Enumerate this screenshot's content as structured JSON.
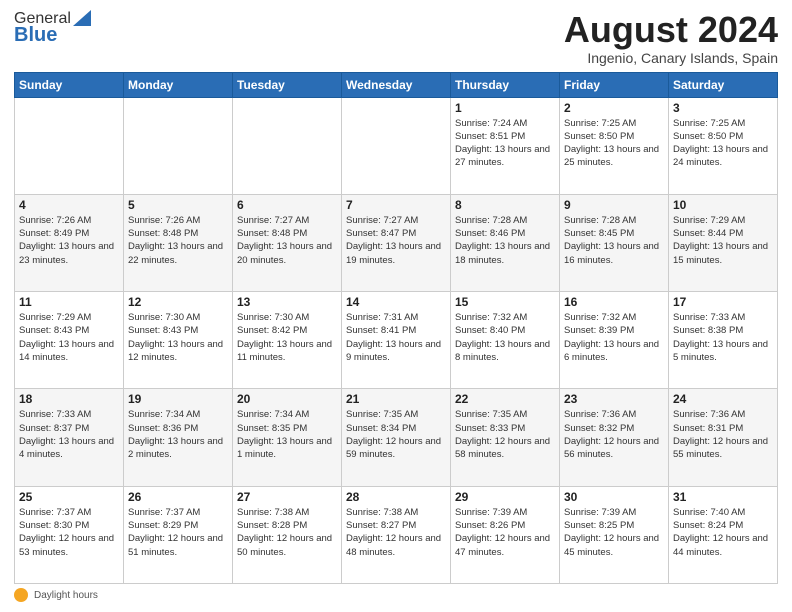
{
  "logo": {
    "general": "General",
    "blue": "Blue"
  },
  "title": "August 2024",
  "location": "Ingenio, Canary Islands, Spain",
  "days_of_week": [
    "Sunday",
    "Monday",
    "Tuesday",
    "Wednesday",
    "Thursday",
    "Friday",
    "Saturday"
  ],
  "footer_label": "Daylight hours",
  "weeks": [
    [
      {
        "day": "",
        "info": ""
      },
      {
        "day": "",
        "info": ""
      },
      {
        "day": "",
        "info": ""
      },
      {
        "day": "",
        "info": ""
      },
      {
        "day": "1",
        "info": "Sunrise: 7:24 AM\nSunset: 8:51 PM\nDaylight: 13 hours and 27 minutes."
      },
      {
        "day": "2",
        "info": "Sunrise: 7:25 AM\nSunset: 8:50 PM\nDaylight: 13 hours and 25 minutes."
      },
      {
        "day": "3",
        "info": "Sunrise: 7:25 AM\nSunset: 8:50 PM\nDaylight: 13 hours and 24 minutes."
      }
    ],
    [
      {
        "day": "4",
        "info": "Sunrise: 7:26 AM\nSunset: 8:49 PM\nDaylight: 13 hours and 23 minutes."
      },
      {
        "day": "5",
        "info": "Sunrise: 7:26 AM\nSunset: 8:48 PM\nDaylight: 13 hours and 22 minutes."
      },
      {
        "day": "6",
        "info": "Sunrise: 7:27 AM\nSunset: 8:48 PM\nDaylight: 13 hours and 20 minutes."
      },
      {
        "day": "7",
        "info": "Sunrise: 7:27 AM\nSunset: 8:47 PM\nDaylight: 13 hours and 19 minutes."
      },
      {
        "day": "8",
        "info": "Sunrise: 7:28 AM\nSunset: 8:46 PM\nDaylight: 13 hours and 18 minutes."
      },
      {
        "day": "9",
        "info": "Sunrise: 7:28 AM\nSunset: 8:45 PM\nDaylight: 13 hours and 16 minutes."
      },
      {
        "day": "10",
        "info": "Sunrise: 7:29 AM\nSunset: 8:44 PM\nDaylight: 13 hours and 15 minutes."
      }
    ],
    [
      {
        "day": "11",
        "info": "Sunrise: 7:29 AM\nSunset: 8:43 PM\nDaylight: 13 hours and 14 minutes."
      },
      {
        "day": "12",
        "info": "Sunrise: 7:30 AM\nSunset: 8:43 PM\nDaylight: 13 hours and 12 minutes."
      },
      {
        "day": "13",
        "info": "Sunrise: 7:30 AM\nSunset: 8:42 PM\nDaylight: 13 hours and 11 minutes."
      },
      {
        "day": "14",
        "info": "Sunrise: 7:31 AM\nSunset: 8:41 PM\nDaylight: 13 hours and 9 minutes."
      },
      {
        "day": "15",
        "info": "Sunrise: 7:32 AM\nSunset: 8:40 PM\nDaylight: 13 hours and 8 minutes."
      },
      {
        "day": "16",
        "info": "Sunrise: 7:32 AM\nSunset: 8:39 PM\nDaylight: 13 hours and 6 minutes."
      },
      {
        "day": "17",
        "info": "Sunrise: 7:33 AM\nSunset: 8:38 PM\nDaylight: 13 hours and 5 minutes."
      }
    ],
    [
      {
        "day": "18",
        "info": "Sunrise: 7:33 AM\nSunset: 8:37 PM\nDaylight: 13 hours and 4 minutes."
      },
      {
        "day": "19",
        "info": "Sunrise: 7:34 AM\nSunset: 8:36 PM\nDaylight: 13 hours and 2 minutes."
      },
      {
        "day": "20",
        "info": "Sunrise: 7:34 AM\nSunset: 8:35 PM\nDaylight: 13 hours and 1 minute."
      },
      {
        "day": "21",
        "info": "Sunrise: 7:35 AM\nSunset: 8:34 PM\nDaylight: 12 hours and 59 minutes."
      },
      {
        "day": "22",
        "info": "Sunrise: 7:35 AM\nSunset: 8:33 PM\nDaylight: 12 hours and 58 minutes."
      },
      {
        "day": "23",
        "info": "Sunrise: 7:36 AM\nSunset: 8:32 PM\nDaylight: 12 hours and 56 minutes."
      },
      {
        "day": "24",
        "info": "Sunrise: 7:36 AM\nSunset: 8:31 PM\nDaylight: 12 hours and 55 minutes."
      }
    ],
    [
      {
        "day": "25",
        "info": "Sunrise: 7:37 AM\nSunset: 8:30 PM\nDaylight: 12 hours and 53 minutes."
      },
      {
        "day": "26",
        "info": "Sunrise: 7:37 AM\nSunset: 8:29 PM\nDaylight: 12 hours and 51 minutes."
      },
      {
        "day": "27",
        "info": "Sunrise: 7:38 AM\nSunset: 8:28 PM\nDaylight: 12 hours and 50 minutes."
      },
      {
        "day": "28",
        "info": "Sunrise: 7:38 AM\nSunset: 8:27 PM\nDaylight: 12 hours and 48 minutes."
      },
      {
        "day": "29",
        "info": "Sunrise: 7:39 AM\nSunset: 8:26 PM\nDaylight: 12 hours and 47 minutes."
      },
      {
        "day": "30",
        "info": "Sunrise: 7:39 AM\nSunset: 8:25 PM\nDaylight: 12 hours and 45 minutes."
      },
      {
        "day": "31",
        "info": "Sunrise: 7:40 AM\nSunset: 8:24 PM\nDaylight: 12 hours and 44 minutes."
      }
    ]
  ]
}
